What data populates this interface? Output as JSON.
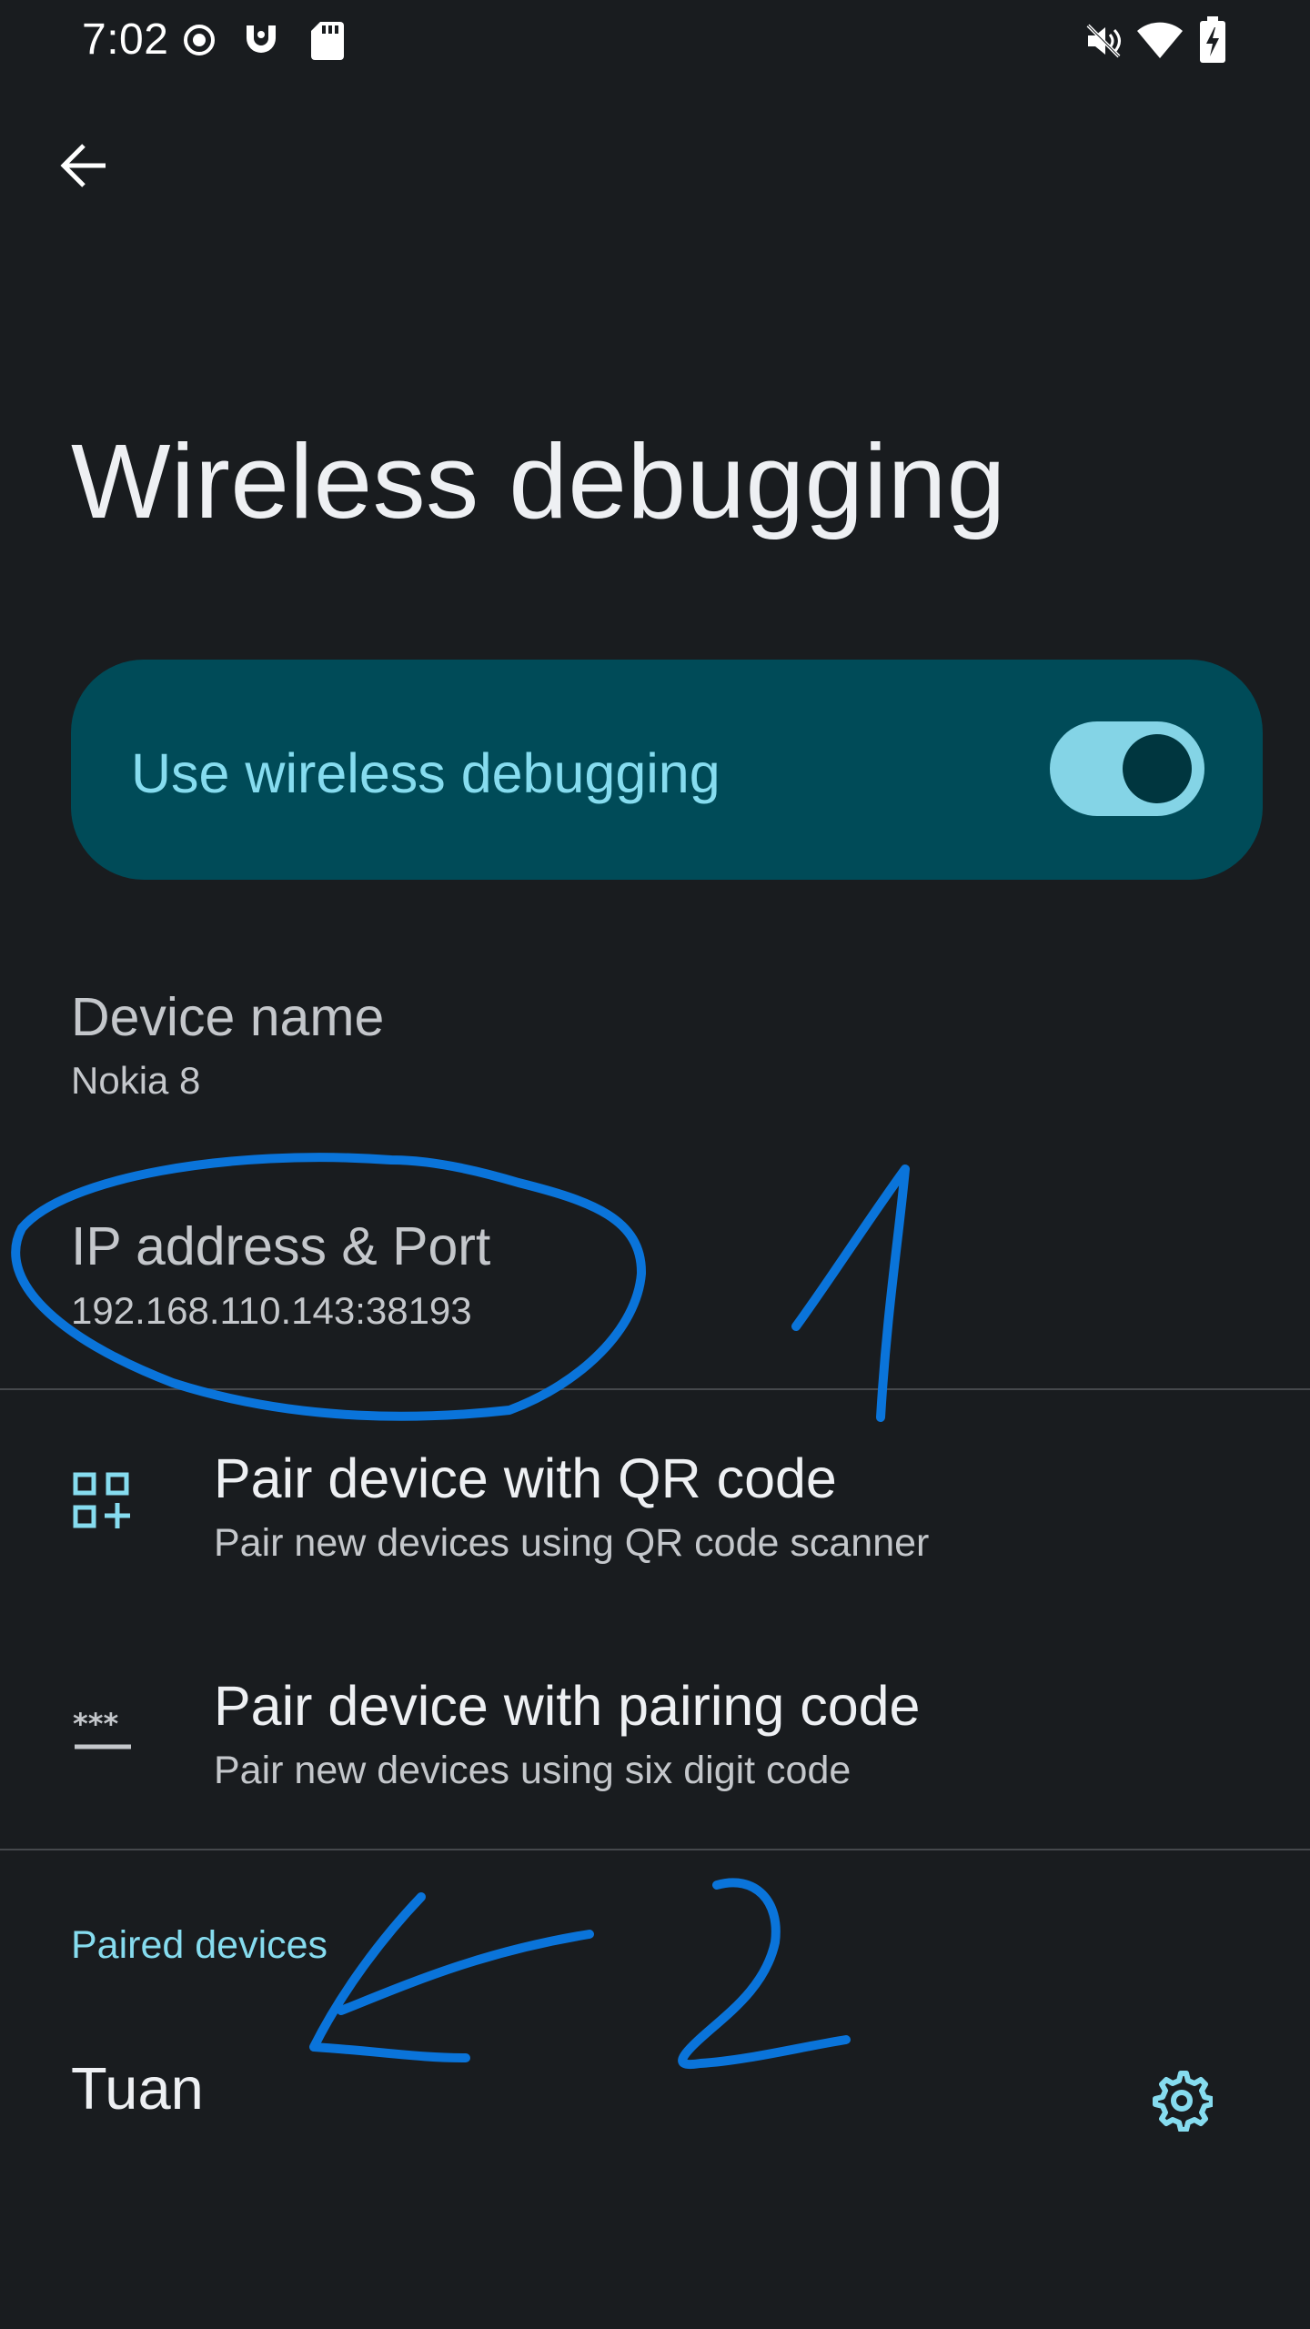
{
  "status_bar": {
    "time": "7:02",
    "icons": [
      "record-icon",
      "notification-app-icon",
      "sd-card-icon",
      "mute-icon",
      "wifi-icon",
      "battery-charging-icon"
    ]
  },
  "header": {
    "back_icon": "arrow-back-icon",
    "title": "Wireless debugging"
  },
  "main_switch": {
    "label": "Use wireless debugging",
    "checked": true,
    "colors": {
      "card": "#004b58",
      "label": "#86dcef",
      "track": "#84d4e6",
      "thumb": "#00363f"
    }
  },
  "device_name": {
    "title": "Device name",
    "value": "Nokia 8"
  },
  "ip_port": {
    "title": "IP address & Port",
    "value": "192.168.110.143:38193"
  },
  "pair_qr": {
    "icon": "qr-code-scanner-icon",
    "title": "Pair device with QR code",
    "subtitle": "Pair new devices using QR code scanner"
  },
  "pair_code": {
    "icon": "password-icon",
    "title": "Pair device with pairing code",
    "subtitle": "Pair new devices using six digit code"
  },
  "paired_devices": {
    "header": "Paired devices",
    "items": [
      {
        "name": "Tuan",
        "icon": "gear-icon"
      }
    ]
  },
  "annotations": {
    "color": "#0a74da",
    "labels": [
      "1",
      "2"
    ]
  }
}
